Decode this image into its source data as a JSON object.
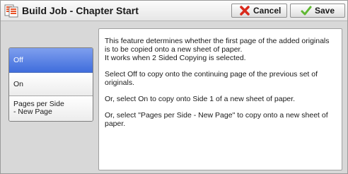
{
  "window": {
    "title": "Build Job - Chapter Start",
    "title_icon": "build-job-icon"
  },
  "toolbar": {
    "cancel_label": "Cancel",
    "cancel_icon": "cancel-x-icon",
    "save_label": "Save",
    "save_icon": "checkmark-icon"
  },
  "options": {
    "selected": "Off",
    "items": [
      {
        "label": "Off"
      },
      {
        "label": "On"
      },
      {
        "line1": "Pages per Side",
        "line2": "- New Page"
      }
    ]
  },
  "description": {
    "intro_line1": "This feature determines whether the first page of the added originals is to be copied onto a new sheet of paper.",
    "intro_line2": "It works when 2 Sided Copying is selected.",
    "off_text": "Select Off to copy onto the continuing page of the previous set of originals.",
    "on_text": "Or, select On to copy onto Side 1 of a new sheet of paper.",
    "pages_text": "Or, select \"Pages per Side - New Page\" to copy onto a new sheet of paper."
  },
  "colors": {
    "selected_option": "#4a78e0",
    "cancel_icon": "#d92a1c",
    "save_icon": "#5fb832",
    "title_icon": "#e8542a"
  }
}
